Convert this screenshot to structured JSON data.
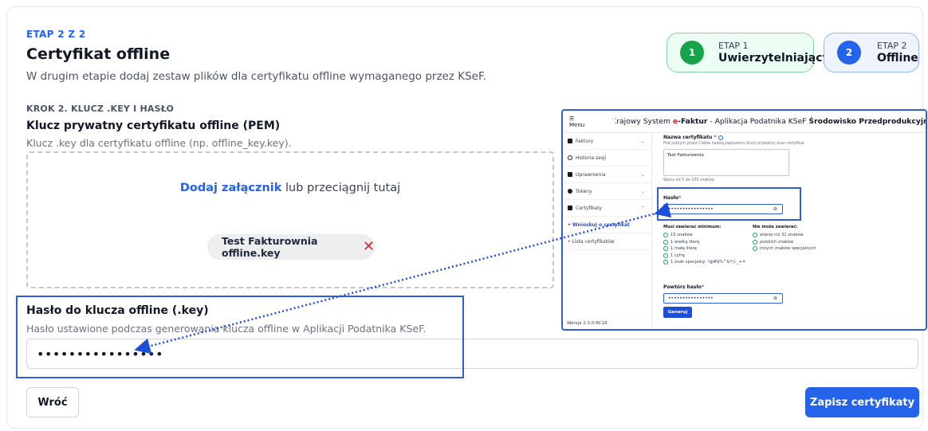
{
  "header": {
    "step_label": "ETAP 2 Z 2",
    "title": "Certyfikat offline",
    "description": "W drugim etapie dodaj zestaw plików dla certyfikatu offline wymaganego przez KSeF."
  },
  "stages": [
    {
      "number": "1",
      "label": "ETAP 1",
      "name": "Uwierzytelniający"
    },
    {
      "number": "2",
      "label": "ETAP 2",
      "name": "Offline"
    }
  ],
  "step2": {
    "label": "KROK 2. KLUCZ .KEY I HASŁO",
    "pem_title": "Klucz prywatny certyfikatu offline (PEM)",
    "pem_desc": "Klucz .key dla certyfikatu offline (np. offline_key.key).",
    "drop_link": "Dodaj załącznik",
    "drop_rest": " lub przeciągnij tutaj",
    "file_name": "Test Fakturownia offline.key",
    "remove_icon": "close-icon"
  },
  "password": {
    "title": "Hasło do klucza offline (.key)",
    "desc": "Hasło ustawione podczas generowania klucza offline w Aplikacji Podatnika KSeF.",
    "value": "••••••••••••••••"
  },
  "buttons": {
    "back": "Wróć",
    "save": "Zapisz certyfikaty"
  },
  "inset": {
    "menu": "☰ Menu",
    "title_pre": "Krajowy System ",
    "title_brand_e": "e",
    "title_brand_rest": "-Faktur",
    "title_mid": " - Aplikacja Podatnika KSeF ",
    "title_env": "Środowisko Przedprodukcyjne",
    "sidebar": [
      {
        "label": "Faktury",
        "chevron": "⌄"
      },
      {
        "label": "Historia sesji",
        "chevron": ""
      },
      {
        "label": "Uprawnienia",
        "chevron": "⌄"
      },
      {
        "label": "Tokeny",
        "chevron": "⌄"
      },
      {
        "label": "Certyfikaty",
        "chevron": "⌃"
      },
      {
        "label": "• Wnioskuj o certyfikat",
        "chevron": ""
      },
      {
        "label": "• Lista certyfikatów",
        "chevron": ""
      }
    ],
    "version": "Wersja 2.3.0-RC18",
    "cert_name_label": "Nazwa certyfikatu",
    "cert_name_hint": "Pod jednym przez Ciebie nazwą zapiszemy klucz prywatny oraz certyfikat",
    "cert_name_value": "Test Fakturownia",
    "cert_counter": "Wpisz od 5 do 100 znaków",
    "pass_label": "Hasło",
    "pass_value": "••••••••••••••••",
    "must_header": "Musi zawierać minimum:",
    "must": [
      "15 znaków",
      "1 wielką literę",
      "1 małą literę",
      "1 cyfrę",
      "1 znak specjalny: !@#$%^&*()-_+="
    ],
    "cant_header": "Nie może zawierać:",
    "cant": [
      "więcej niż 32 znaków",
      "polskich znaków",
      "innych znaków specjalnych"
    ],
    "repeat_label": "Powtórz hasło",
    "repeat_value": "••••••••••••••••",
    "generate": "Generuj",
    "required_mark": "*"
  }
}
